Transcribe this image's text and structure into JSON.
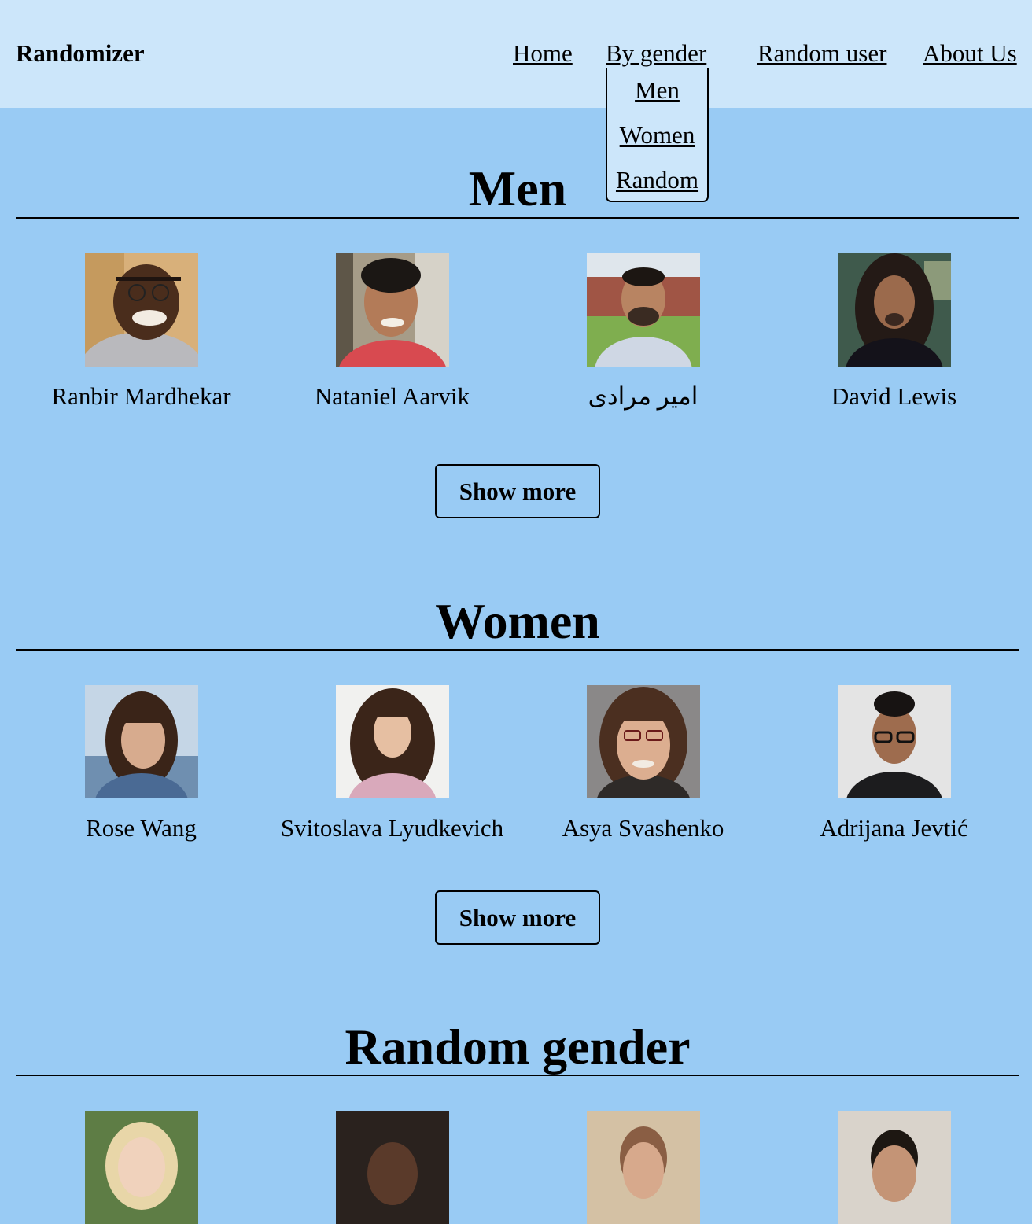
{
  "header": {
    "brand": "Randomizer",
    "nav": {
      "home": "Home",
      "by_gender": "By gender",
      "random_user": "Random user",
      "about_us": "About Us"
    },
    "dropdown": [
      "Men",
      "Women",
      "Random"
    ]
  },
  "sections": [
    {
      "title": "Men",
      "users": [
        {
          "name": "Ranbir Mardhekar"
        },
        {
          "name": "Nataniel Aarvik"
        },
        {
          "name": "امیر مرادی"
        },
        {
          "name": "David Lewis"
        }
      ],
      "button": "Show more"
    },
    {
      "title": "Women",
      "users": [
        {
          "name": "Rose Wang"
        },
        {
          "name": "Svitoslava Lyudkevich"
        },
        {
          "name": "Asya Svashenko"
        },
        {
          "name": "Adrijana Jevtić"
        }
      ],
      "button": "Show more"
    },
    {
      "title": "Random gender"
    }
  ],
  "colors": {
    "header_bg": "#cce6fa",
    "page_bg": "#99cbf4"
  }
}
